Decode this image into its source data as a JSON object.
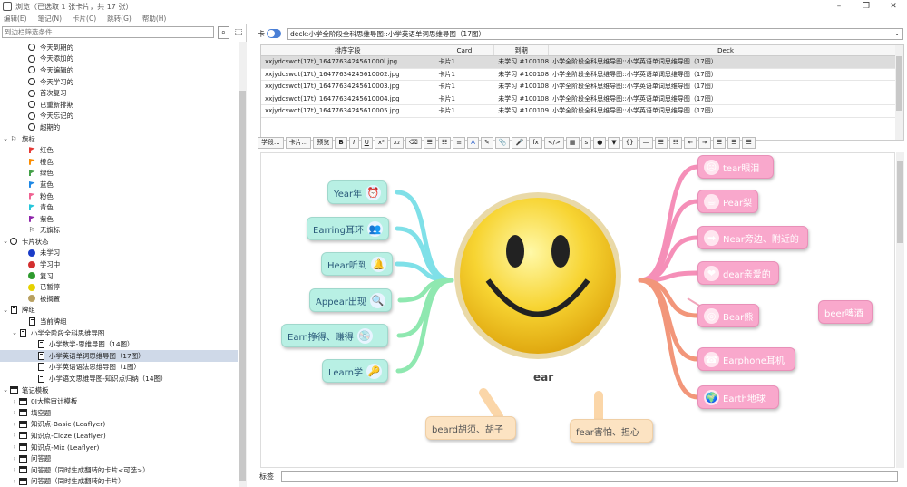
{
  "window": {
    "title": "浏览（已选取 1 张卡片，共 17 张）",
    "controls": [
      "–",
      "❐",
      "✕"
    ]
  },
  "menu": [
    "编辑(E)",
    "笔记(N)",
    "卡片(C)",
    "跳转(G)",
    "帮助(H)"
  ],
  "sidebar": {
    "search_placeholder": "到边栏筛选条件",
    "search_icon": "search-icon",
    "items": [
      {
        "label": "今天到期的",
        "indent": 2,
        "icon": "clock"
      },
      {
        "label": "今天添加的",
        "indent": 2,
        "icon": "clock"
      },
      {
        "label": "今天编辑的",
        "indent": 2,
        "icon": "clock"
      },
      {
        "label": "今天学习的",
        "indent": 2,
        "icon": "clock"
      },
      {
        "label": "首次复习",
        "indent": 2,
        "icon": "clock"
      },
      {
        "label": "已重新排期",
        "indent": 2,
        "icon": "clock"
      },
      {
        "label": "今天忘记的",
        "indent": 2,
        "icon": "clock"
      },
      {
        "label": "超期的",
        "indent": 2,
        "icon": "clock"
      },
      {
        "label": "旗标",
        "indent": 0,
        "icon": "flag-outline",
        "arrow": "⌄"
      },
      {
        "label": "红色",
        "indent": 2,
        "icon": "flag",
        "color": "#e53935"
      },
      {
        "label": "橙色",
        "indent": 2,
        "icon": "flag",
        "color": "#fb8c00"
      },
      {
        "label": "绿色",
        "indent": 2,
        "icon": "flag",
        "color": "#43a047"
      },
      {
        "label": "蓝色",
        "indent": 2,
        "icon": "flag",
        "color": "#1e88e5"
      },
      {
        "label": "粉色",
        "indent": 2,
        "icon": "flag",
        "color": "#f06292"
      },
      {
        "label": "青色",
        "indent": 2,
        "icon": "flag",
        "color": "#26c6da"
      },
      {
        "label": "紫色",
        "indent": 2,
        "icon": "flag",
        "color": "#8e24aa"
      },
      {
        "label": "无旗标",
        "indent": 2,
        "icon": "flag-outline"
      },
      {
        "label": "卡片状态",
        "indent": 0,
        "icon": "circle-outline",
        "arrow": "⌄"
      },
      {
        "label": "未学习",
        "indent": 2,
        "icon": "circle",
        "color": "#1a3cc8"
      },
      {
        "label": "学习中",
        "indent": 2,
        "icon": "circle",
        "color": "#d32f2f"
      },
      {
        "label": "复习",
        "indent": 2,
        "icon": "circle",
        "color": "#2e9a2e"
      },
      {
        "label": "已暂停",
        "indent": 2,
        "icon": "circle",
        "color": "#e6d200"
      },
      {
        "label": "被搁置",
        "indent": 2,
        "icon": "circle",
        "color": "#b8a060"
      },
      {
        "label": "牌组",
        "indent": 0,
        "icon": "deck",
        "arrow": "⌄"
      },
      {
        "label": "当前牌组",
        "indent": 2,
        "icon": "deck"
      },
      {
        "label": "小学全阶段全科思维导图",
        "indent": 1,
        "icon": "deck",
        "arrow": "⌄"
      },
      {
        "label": "小学数学-思维导图（14图）",
        "indent": 3,
        "icon": "deck"
      },
      {
        "label": "小学英语单词思维导图（17图）",
        "indent": 3,
        "icon": "deck",
        "selected": true
      },
      {
        "label": "小学英语语法思维导图（1图）",
        "indent": 3,
        "icon": "deck"
      },
      {
        "label": "小学语文思维导图-知识点归纳（14图）",
        "indent": 3,
        "icon": "deck"
      },
      {
        "label": "笔记模板",
        "indent": 0,
        "icon": "note",
        "arrow": "⌄"
      },
      {
        "label": "0I大熊审计模板",
        "indent": 1,
        "icon": "note",
        "arrow": "›"
      },
      {
        "label": "填空题",
        "indent": 1,
        "icon": "note",
        "arrow": "›"
      },
      {
        "label": "知识点-Basic (Leaflyer)",
        "indent": 1,
        "icon": "note",
        "arrow": "›"
      },
      {
        "label": "知识点-Cloze (Leaflyer)",
        "indent": 1,
        "icon": "note",
        "arrow": "›"
      },
      {
        "label": "知识点-Mix (Leaflyer)",
        "indent": 1,
        "icon": "note",
        "arrow": "›"
      },
      {
        "label": "问答题",
        "indent": 1,
        "icon": "note",
        "arrow": "›"
      },
      {
        "label": "问答题（同时生成翻转的卡片<可选>）",
        "indent": 1,
        "icon": "note",
        "arrow": "›"
      },
      {
        "label": "问答题（同时生成翻转的卡片）",
        "indent": 1,
        "icon": "note",
        "arrow": "›",
        "selected_partial": true
      }
    ]
  },
  "browser": {
    "mode_label": "卡",
    "search_value": "deck:小学全阶段全科思维导图::小学英语单词思维导图（17图）",
    "columns": [
      "排序字段",
      "Card",
      "到期",
      "Deck"
    ],
    "rows": [
      [
        "xxjydcswdt(17t)_1647763424561000l.jpg",
        "卡片1",
        "未学习 #1001086",
        "小学全阶段全科思维导图::小学英语单词思维导图（17图）"
      ],
      [
        "xxjydcswdt(17t)_16477634245610002.jpg",
        "卡片1",
        "未学习 #1001087",
        "小学全阶段全科思维导图::小学英语单词思维导图（17图）"
      ],
      [
        "xxjydcswdt(17t)_16477634245610003.jpg",
        "卡片1",
        "未学习 #1001088",
        "小学全阶段全科思维导图::小学英语单词思维导图（17图）"
      ],
      [
        "xxjydcswdt(17t)_16477634245610004.jpg",
        "卡片1",
        "未学习 #1001089",
        "小学全阶段全科思维导图::小学英语单词思维导图（17图）"
      ],
      [
        "xxjydcswdt(17t)_16477634245610005.jpg",
        "卡片1",
        "未学习 #1001090",
        "小学全阶段全科思维导图::小学英语单词思维导图（17图）"
      ]
    ]
  },
  "editor": {
    "toolbar_fields": [
      "学段...",
      "卡片...",
      "预览"
    ],
    "toolbar_buttons": [
      "B",
      "I",
      "U",
      "x²",
      "x₂",
      "⌫",
      "☰",
      "☷",
      "≡",
      "A",
      "✎",
      "📎",
      "🎤",
      "fx",
      "</>",
      "▦",
      "s",
      "●",
      "▼",
      "{}",
      "—",
      "☰",
      "☷",
      "⇤",
      "⇥",
      "☰",
      "☰",
      "☰"
    ],
    "tags_label": "标签"
  },
  "mindmap": {
    "center": "ear",
    "left_nodes": [
      {
        "label": "Year年",
        "icon": "⏰"
      },
      {
        "label": "Earring耳环",
        "icon": "👥"
      },
      {
        "label": "Hear听到",
        "icon": "🔔"
      },
      {
        "label": "Appear出现",
        "icon": "🔍"
      },
      {
        "label": "Earn挣得、赚得",
        "icon": "💿"
      },
      {
        "label": "Learn学",
        "icon": "🔑"
      }
    ],
    "right_nodes": [
      {
        "label": "tear眼泪",
        "icon": "☹"
      },
      {
        "label": "Pear梨",
        "icon": "☕"
      },
      {
        "label": "Near旁边、附近的",
        "icon": "➡"
      },
      {
        "label": "dear亲爱的",
        "icon": "❤"
      },
      {
        "label": "Bear熊",
        "icon": "◎"
      },
      {
        "label": "Earphone耳机",
        "icon": "☎"
      },
      {
        "label": "Earth地球",
        "icon": "🌍"
      }
    ],
    "branch_node": "beer啤酒",
    "bottom_nodes": [
      "beard胡须、胡子",
      "fear害怕、担心"
    ]
  }
}
